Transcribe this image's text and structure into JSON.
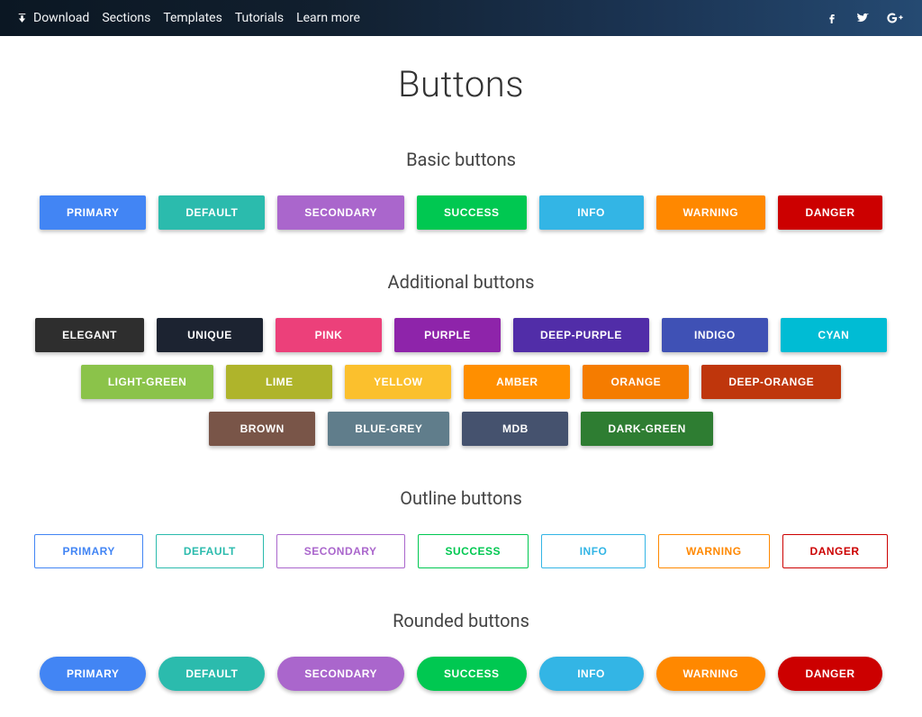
{
  "nav": {
    "items": [
      {
        "label": "Download"
      },
      {
        "label": "Sections"
      },
      {
        "label": "Templates"
      },
      {
        "label": "Tutorials"
      },
      {
        "label": "Learn more"
      }
    ],
    "social": [
      "facebook",
      "twitter",
      "google-plus"
    ]
  },
  "page": {
    "title": "Buttons"
  },
  "sections": {
    "basic": {
      "title": "Basic buttons",
      "buttons": [
        {
          "label": "PRIMARY",
          "bg": "#4285f4"
        },
        {
          "label": "DEFAULT",
          "bg": "#2bbbad"
        },
        {
          "label": "SECONDARY",
          "bg": "#a a",
          "bg_": "#aa66cc"
        },
        {
          "label": "SUCCESS",
          "bg": "#00c851"
        },
        {
          "label": "INFO",
          "bg": "#33b5e5"
        },
        {
          "label": "WARNING",
          "bg": "#ff8800"
        },
        {
          "label": "DANGER",
          "bg": "#cc0000"
        }
      ]
    },
    "additional": {
      "title": "Additional buttons",
      "buttons": [
        {
          "label": "ELEGANT",
          "bg": "#2e2e2e"
        },
        {
          "label": "UNIQUE",
          "bg": "#1c2331"
        },
        {
          "label": "PINK",
          "bg": "#ec407a"
        },
        {
          "label": "PURPLE",
          "bg": "#8e24aa"
        },
        {
          "label": "DEEP-PURPLE",
          "bg": "#512da8"
        },
        {
          "label": "INDIGO",
          "bg": "#3f51b5"
        },
        {
          "label": "CYAN",
          "bg": "#00bcd4"
        },
        {
          "label": "LIGHT-GREEN",
          "bg": "#8bc34a"
        },
        {
          "label": "LIME",
          "bg": "#afb42b"
        },
        {
          "label": "YELLOW",
          "bg": "#fbc02d"
        },
        {
          "label": "AMBER",
          "bg": "#ff8f00"
        },
        {
          "label": "ORANGE",
          "bg": "#f57c00"
        },
        {
          "label": "DEEP-ORANGE",
          "bg": "#bf360c"
        },
        {
          "label": "BROWN",
          "bg": "#795548"
        },
        {
          "label": "BLUE-GREY",
          "bg": "#607d8b"
        },
        {
          "label": "MDB",
          "bg": "#45526e"
        },
        {
          "label": "DARK-GREEN",
          "bg": "#2e7d32"
        }
      ]
    },
    "outline": {
      "title": "Outline buttons",
      "buttons": [
        {
          "label": "PRIMARY",
          "color": "#4285f4"
        },
        {
          "label": "DEFAULT",
          "color": "#2bbbad"
        },
        {
          "label": "SECONDARY",
          "color": "#aa66cc"
        },
        {
          "label": "SUCCESS",
          "color": "#00c851"
        },
        {
          "label": "INFO",
          "color": "#33b5e5"
        },
        {
          "label": "WARNING",
          "color": "#ff8800"
        },
        {
          "label": "DANGER",
          "color": "#cc0000"
        }
      ]
    },
    "rounded": {
      "title": "Rounded buttons",
      "buttons": [
        {
          "label": "PRIMARY",
          "bg": "#4285f4"
        },
        {
          "label": "DEFAULT",
          "bg": "#2bbbad"
        },
        {
          "label": "SECONDARY",
          "bg": "#aa66cc"
        },
        {
          "label": "SUCCESS",
          "bg": "#00c851"
        },
        {
          "label": "INFO",
          "bg": "#33b5e5"
        },
        {
          "label": "WARNING",
          "bg": "#ff8800"
        },
        {
          "label": "DANGER",
          "bg": "#cc0000"
        }
      ]
    }
  }
}
